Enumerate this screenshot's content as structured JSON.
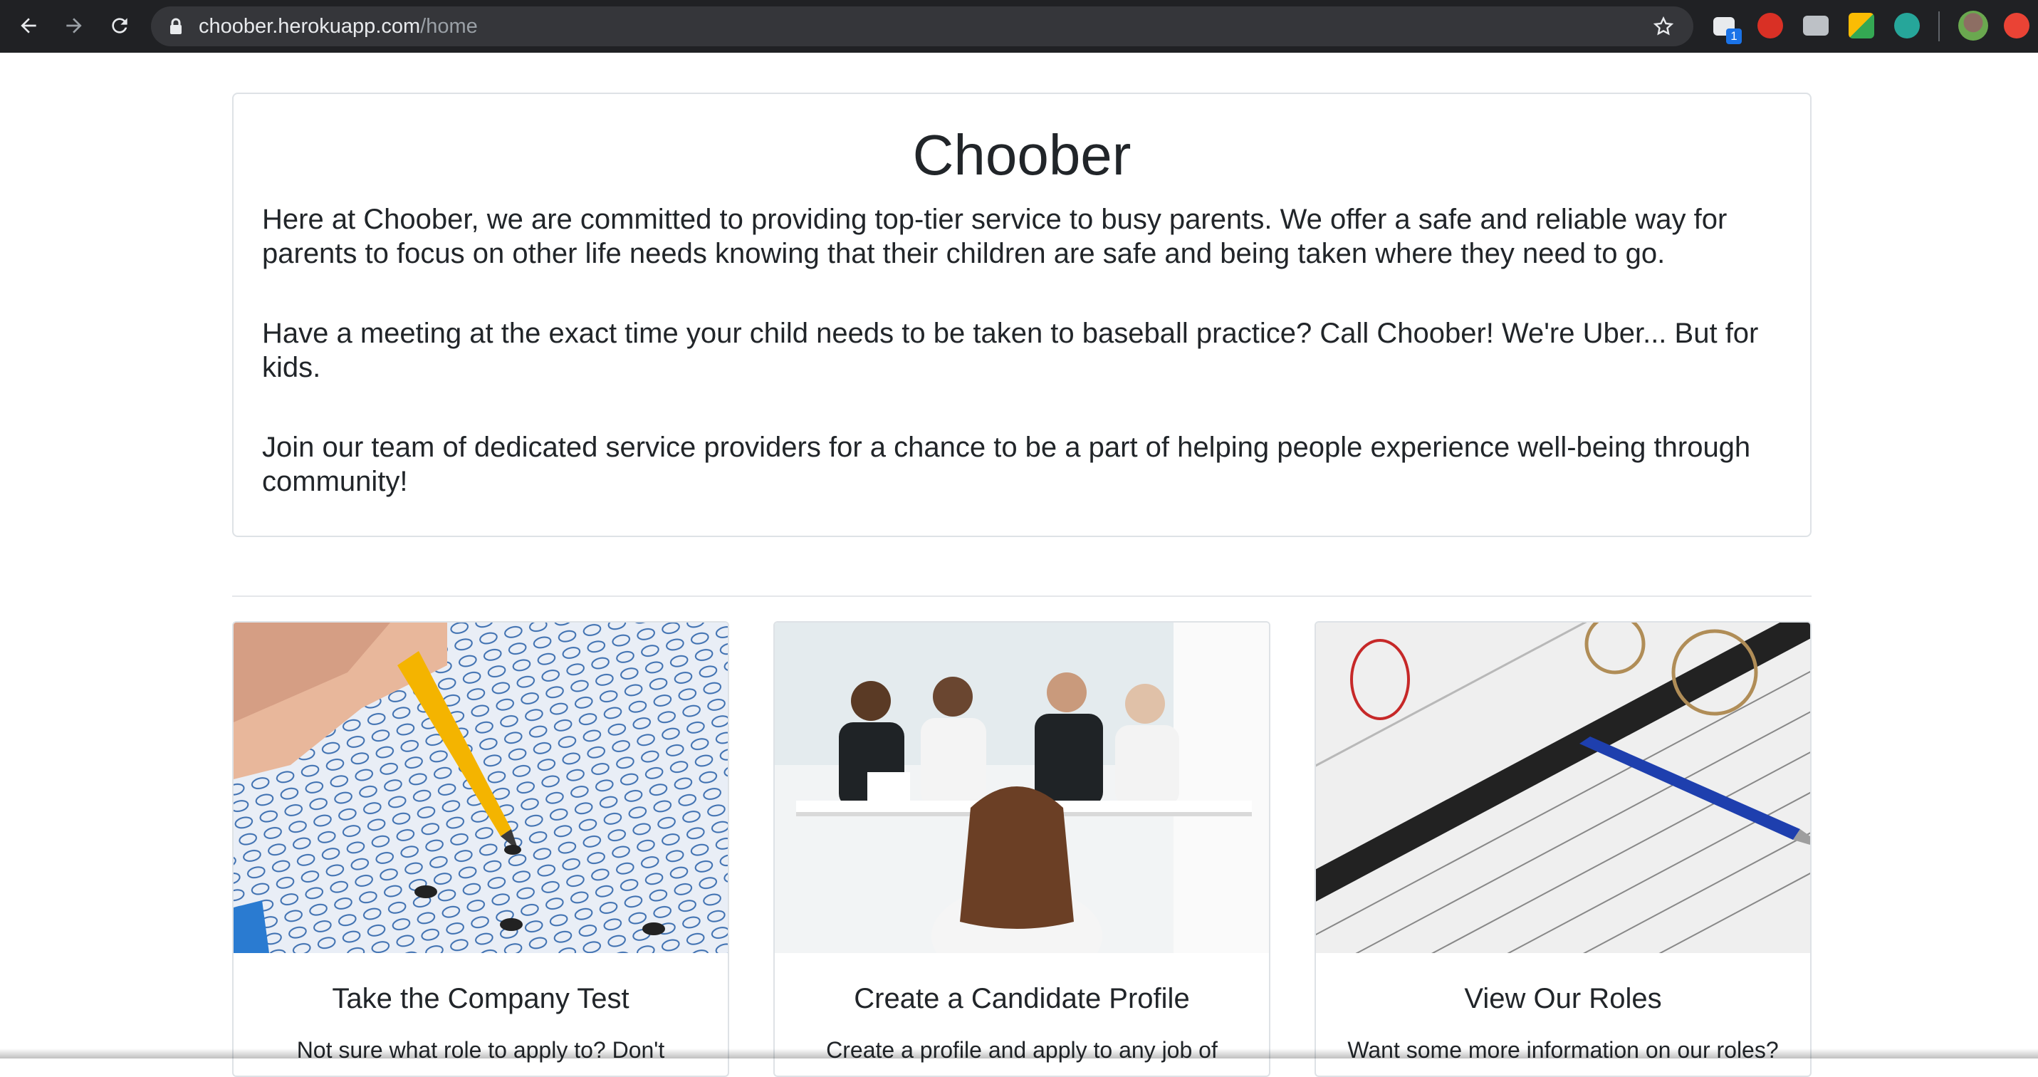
{
  "browser": {
    "url_host": "choober.herokuapp.com",
    "url_path": "/home",
    "extension_badge": "1",
    "icons": [
      "back-arrow-icon",
      "forward-arrow-icon",
      "reload-icon",
      "lock-icon",
      "star-icon",
      "extension-icon",
      "profile-avatar"
    ]
  },
  "hero": {
    "title": "Choober",
    "paragraphs": [
      "Here at Choober, we are committed to providing top-tier service to busy parents. We offer a safe and reliable way for parents to focus on other life needs knowing that their children are safe and being taken where they need to go.",
      "Have a meeting at the exact time your child needs to be taken to baseball practice? Call Choober! We're Uber... But for kids.",
      "Join our team of dedicated service providers for a chance to be a part of helping people experience well-being through community!"
    ]
  },
  "cards": [
    {
      "title": "Take the Company Test",
      "text": "Not sure what role to apply to? Don't",
      "image": "answer-sheet-photo"
    },
    {
      "title": "Create a Candidate Profile",
      "text": "Create a profile and apply to any job of",
      "image": "interview-panel-photo"
    },
    {
      "title": "View Our Roles",
      "text": "Want some more information on our roles?",
      "image": "job-description-photo"
    }
  ],
  "colors": {
    "chrome": "#202124",
    "omnibox": "#35363a",
    "text": "#212529",
    "border": "#dee2e6"
  }
}
